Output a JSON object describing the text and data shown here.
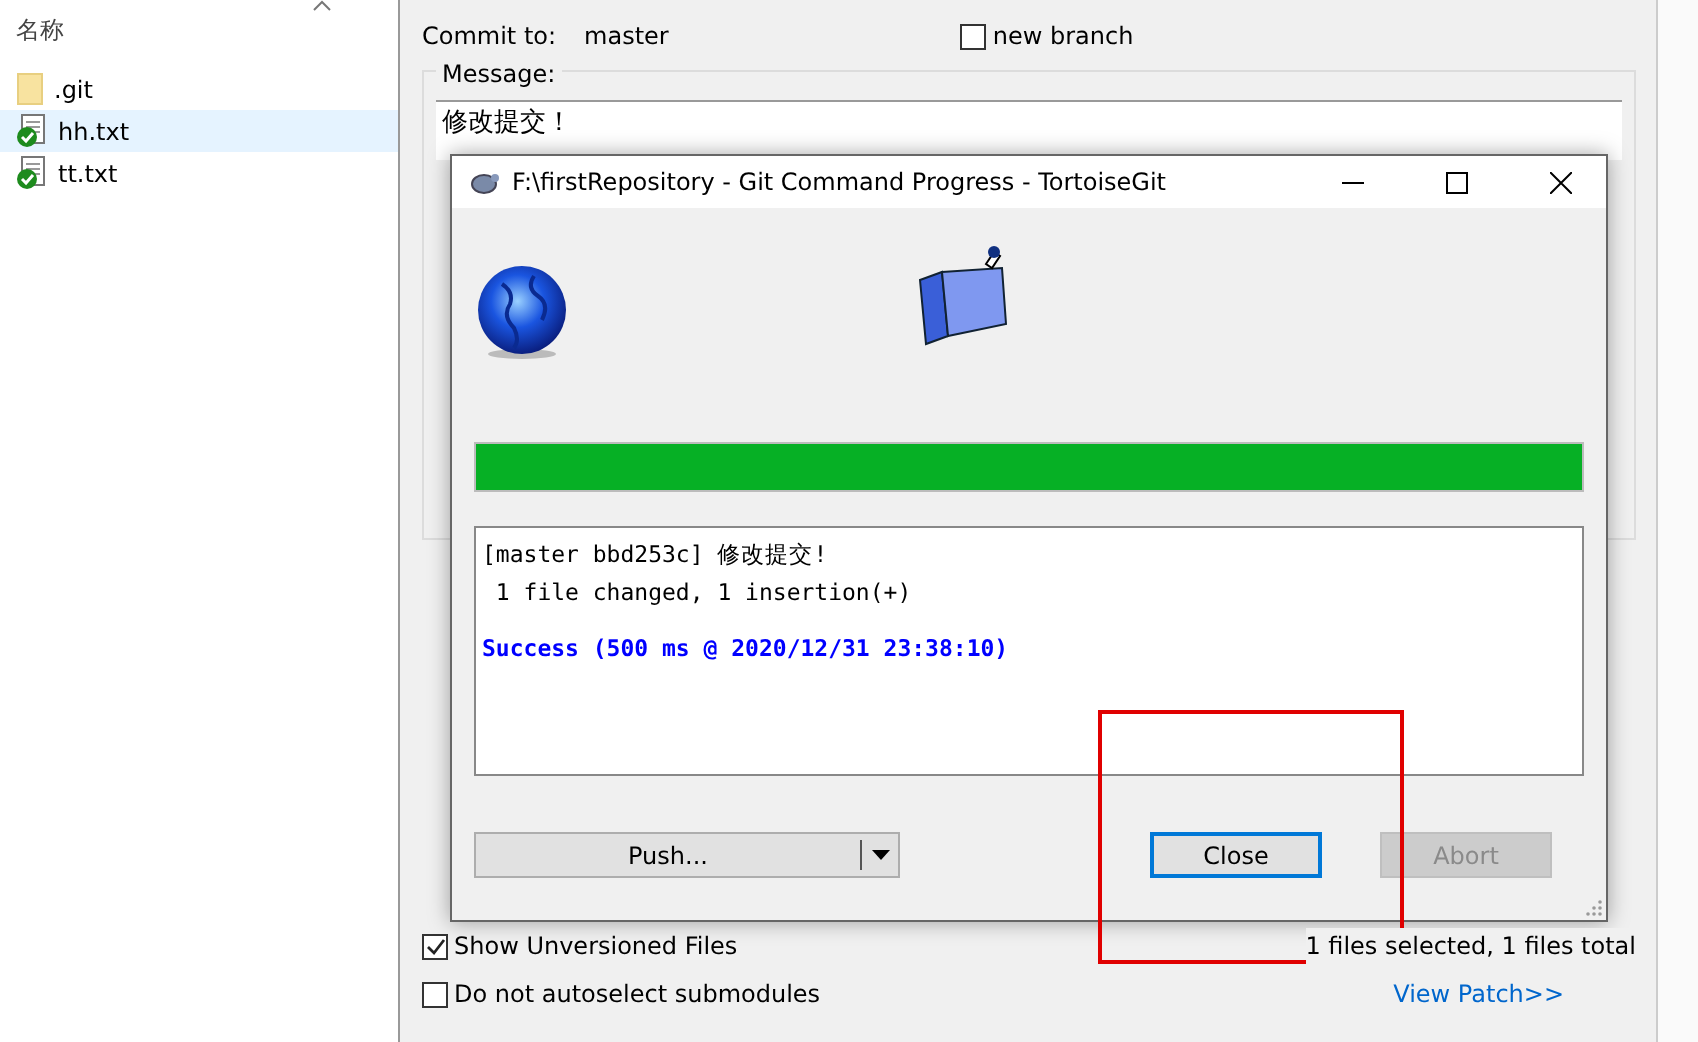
{
  "explorer": {
    "column_header": "名称",
    "files": [
      {
        "name": ".git",
        "kind": "folder",
        "selected": false
      },
      {
        "name": "hh.txt",
        "kind": "file",
        "selected": true
      },
      {
        "name": "tt.txt",
        "kind": "file",
        "selected": false
      }
    ]
  },
  "commit": {
    "commit_to_label": "Commit to:",
    "branch": "master",
    "new_branch": {
      "label": "new branch",
      "checked": false
    },
    "message_label": "Message:",
    "message": "修改提交！",
    "show_unversioned": {
      "label": "Show Unversioned Files",
      "checked": true
    },
    "no_autoselect": {
      "label": "Do not autoselect submodules",
      "checked": false
    },
    "files_status": "1 files selected, 1 files total",
    "view_patch": "View Patch>>"
  },
  "progress_dialog": {
    "title": "F:\\firstRepository - Git Command Progress - TortoiseGit",
    "level": 1,
    "log": [
      {
        "text": "[master bbd253c] 修改提交!",
        "kind": "output"
      },
      {
        "text": " 1 file changed, 1 insertion(+)",
        "kind": "output"
      },
      {
        "text": "Success (500 ms @ 2020/12/31 23:38:10)",
        "kind": "success"
      }
    ],
    "buttons": [
      {
        "label": "Push...",
        "kind": "split",
        "disabled": false,
        "focused": false
      },
      {
        "label": "Close",
        "kind": "plain",
        "disabled": false,
        "focused": true
      },
      {
        "label": "Abort",
        "kind": "plain",
        "disabled": true,
        "focused": false
      }
    ]
  }
}
